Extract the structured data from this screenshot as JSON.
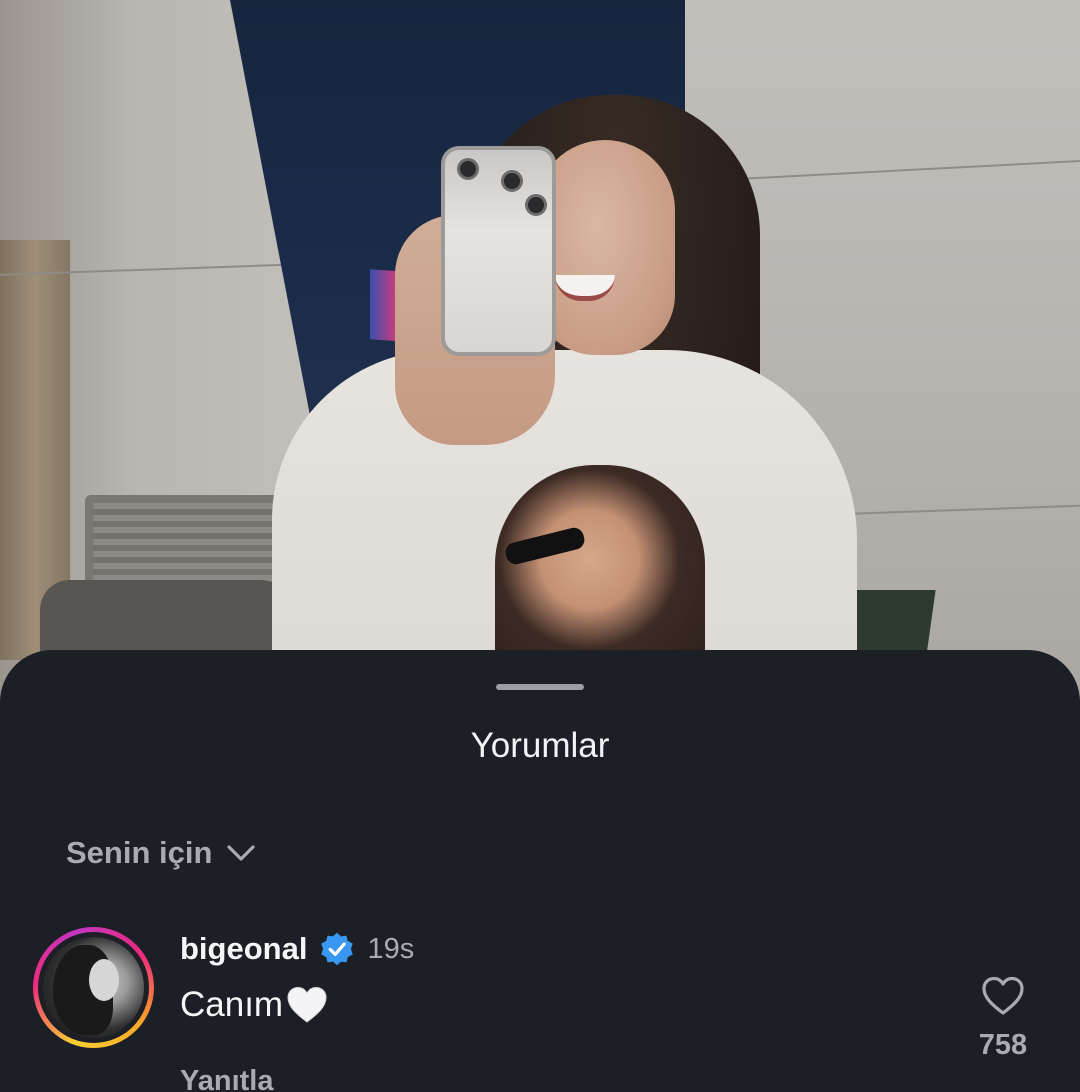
{
  "sheet": {
    "title": "Yorumlar"
  },
  "filter": {
    "label": "Senin için",
    "icon": "chevron-down-icon"
  },
  "comments": [
    {
      "username": "bigeonal",
      "verified": true,
      "time": "19s",
      "text": "Canım",
      "emoji": "white-heart",
      "reply_label": "Yanıtla",
      "like_count": "758"
    }
  ],
  "colors": {
    "sheet_bg": "#1c1f25",
    "primary_text": "#f5f6f8",
    "secondary_text": "#a8abb2",
    "verified_blue": "#3897f0"
  }
}
